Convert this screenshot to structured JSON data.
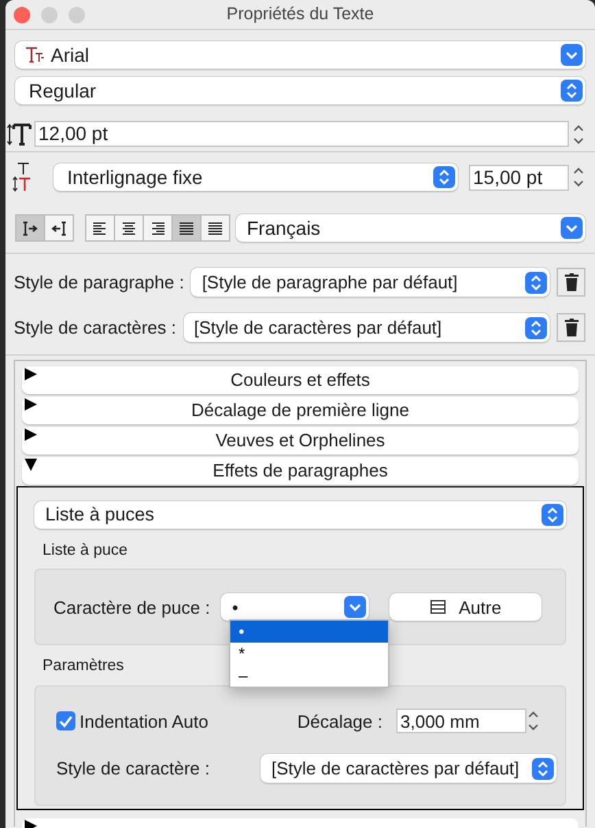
{
  "window": {
    "title": "Propriétés du Texte"
  },
  "font": {
    "family": "Arial",
    "style": "Regular"
  },
  "size": {
    "value": "12,00 pt"
  },
  "line_spacing": {
    "mode": "Interlignage fixe",
    "value": "15,00 pt"
  },
  "direction_buttons": [
    {
      "kind": "ltr",
      "selected": true
    },
    {
      "kind": "rtl",
      "selected": false
    }
  ],
  "alignment_buttons": [
    {
      "kind": "left",
      "selected": false
    },
    {
      "kind": "center",
      "selected": false
    },
    {
      "kind": "right",
      "selected": false
    },
    {
      "kind": "justify",
      "selected": true
    },
    {
      "kind": "force",
      "selected": false
    }
  ],
  "language": "Français",
  "paragraph_style": {
    "label": "Style de paragraphe :",
    "value": "[Style de paragraphe par défaut]"
  },
  "character_style": {
    "label": "Style de caractères :",
    "value": "[Style de caractères par défaut]"
  },
  "sections": [
    {
      "title": "Couleurs et effets",
      "expanded": false
    },
    {
      "title": "Décalage de première ligne",
      "expanded": false
    },
    {
      "title": "Veuves et Orphelines",
      "expanded": false
    },
    {
      "title": "Effets de paragraphes",
      "expanded": true
    }
  ],
  "effects": {
    "list_type": "Liste à puces",
    "bullet_group": {
      "title": "Liste à puce",
      "label": "Caractère de puce :",
      "value": "•",
      "other_button": "Autre",
      "options": [
        {
          "label": "•",
          "selected": true
        },
        {
          "label": "*",
          "selected": false
        },
        {
          "label": "–",
          "selected": false
        }
      ]
    },
    "params_group": {
      "title": "Paramètres",
      "auto_indent": {
        "label": "Indentation Auto",
        "checked": true
      },
      "offset": {
        "label": "Décalage :",
        "value": "3,000 mm"
      },
      "char_style": {
        "label": "Style de caractère :",
        "value": "[Style de caractères par défaut]"
      }
    }
  }
}
